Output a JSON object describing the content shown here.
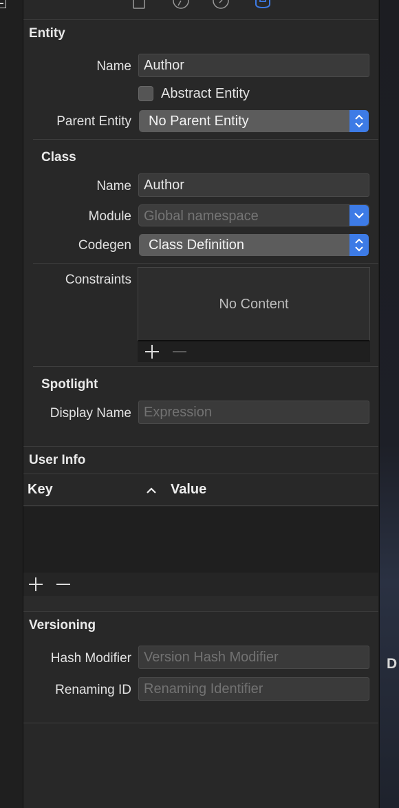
{
  "right_edge_text": "D",
  "entity": {
    "title": "Entity",
    "name_label": "Name",
    "name_value": "Author",
    "abstract_label": "Abstract Entity",
    "abstract_checked": false,
    "parent_label": "Parent Entity",
    "parent_value": "No Parent Entity"
  },
  "class": {
    "title": "Class",
    "name_label": "Name",
    "name_value": "Author",
    "module_label": "Module",
    "module_placeholder": "Global namespace",
    "codegen_label": "Codegen",
    "codegen_value": "Class Definition"
  },
  "constraints": {
    "label": "Constraints",
    "empty_text": "No Content"
  },
  "spotlight": {
    "title": "Spotlight",
    "display_name_label": "Display Name",
    "display_name_placeholder": "Expression"
  },
  "user_info": {
    "title": "User Info",
    "columns": [
      "Key",
      "Value"
    ]
  },
  "versioning": {
    "title": "Versioning",
    "hash_label": "Hash Modifier",
    "hash_placeholder": "Version Hash Modifier",
    "renaming_label": "Renaming ID",
    "renaming_placeholder": "Renaming Identifier"
  },
  "toolbar_icons": [
    "file-inspector-icon",
    "history-inspector-icon",
    "help-inspector-icon",
    "data-model-inspector-icon"
  ],
  "colors": {
    "accent": "#3d7be6",
    "panel": "#282828"
  }
}
